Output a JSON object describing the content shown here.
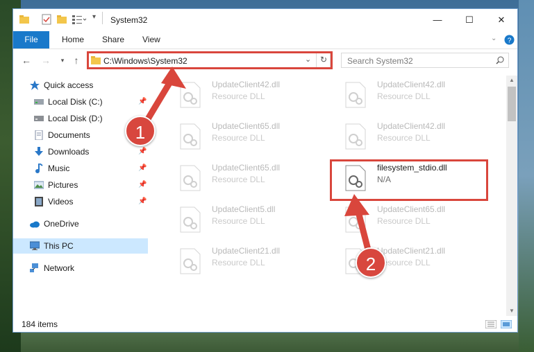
{
  "window": {
    "title": "System32"
  },
  "ribbon": {
    "tabs": [
      "File",
      "Home",
      "Share",
      "View"
    ]
  },
  "address": {
    "path": "C:\\Windows\\System32"
  },
  "search": {
    "placeholder": "Search System32"
  },
  "sidebar": {
    "items": [
      {
        "label": "Quick access",
        "icon": "star-icon"
      },
      {
        "label": "Local Disk (C:)",
        "icon": "drive-icon",
        "pinned": true
      },
      {
        "label": "Local Disk (D:)",
        "icon": "drive-icon"
      },
      {
        "label": "Documents",
        "icon": "documents-icon"
      },
      {
        "label": "Downloads",
        "icon": "download-icon",
        "pinned": true
      },
      {
        "label": "Music",
        "icon": "music-icon",
        "pinned": true
      },
      {
        "label": "Pictures",
        "icon": "pictures-icon",
        "pinned": true
      },
      {
        "label": "Videos",
        "icon": "videos-icon",
        "pinned": true
      },
      {
        "label": "OneDrive",
        "icon": "cloud-icon"
      },
      {
        "label": "This PC",
        "icon": "computer-icon",
        "selected": true
      },
      {
        "label": "Network",
        "icon": "network-icon"
      }
    ]
  },
  "files": [
    {
      "name": "UpdateClient42.dll",
      "type": "Resource DLL"
    },
    {
      "name": "UpdateClient42.dll",
      "type": "Resource DLL"
    },
    {
      "name": "UpdateClient65.dll",
      "type": "Resource DLL"
    },
    {
      "name": "UpdateClient42.dll",
      "type": "Resource DLL"
    },
    {
      "name": "UpdateClient65.dll",
      "type": "Resource DLL"
    },
    {
      "name": "filesystem_stdio.dll",
      "type": "N/A",
      "highlighted": true
    },
    {
      "name": "UpdateClient5.dll",
      "type": "Resource DLL"
    },
    {
      "name": "UpdateClient65.dll",
      "type": "Resource DLL"
    },
    {
      "name": "UpdateClient21.dll",
      "type": "Resource DLL"
    },
    {
      "name": "UpdateClient21.dll",
      "type": "Resource DLL"
    }
  ],
  "status": {
    "item_count": "184 items"
  },
  "callouts": {
    "one": "1",
    "two": "2"
  },
  "colors": {
    "accent": "#1979ca",
    "highlight": "#d9463c",
    "selected": "#cce8ff"
  }
}
